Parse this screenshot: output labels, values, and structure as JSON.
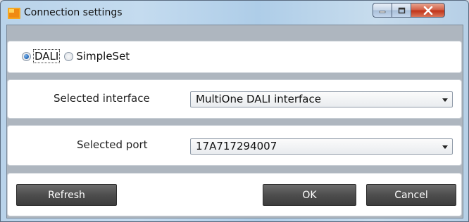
{
  "window": {
    "title": "Connection settings",
    "icon": "app-icon",
    "controls": {
      "minimize_icon": "minimize-icon",
      "maximize_icon": "maximize-icon",
      "close_icon": "close-icon"
    }
  },
  "mode": {
    "options": [
      {
        "label": "DALI",
        "selected": true
      },
      {
        "label": "SimpleSet",
        "selected": false
      }
    ]
  },
  "interface": {
    "label": "Selected interface",
    "value": "MultiOne DALI interface"
  },
  "port": {
    "label": "Selected port",
    "value": "17A717294007"
  },
  "actions": {
    "refresh_label": "Refresh",
    "ok_label": "OK",
    "cancel_label": "Cancel"
  },
  "colors": {
    "button_bg": "#4e4e4e",
    "button_text": "#ffffff",
    "close_button": "#c7472c",
    "panel_bg": "#ffffff",
    "dialog_bg": "#aeb6bf"
  }
}
